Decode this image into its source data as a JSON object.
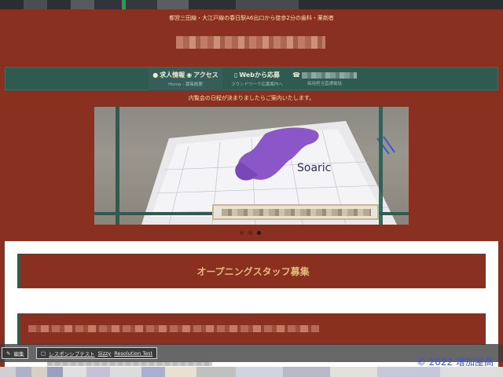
{
  "subtitle": "都営三田線・大江戸線の春日駅A6出口から徒歩2分の歯科・薬剤者",
  "nav": {
    "items": [
      {
        "main": "求人情報",
        "sub": "Home - 募集概要",
        "icon": "user-icon"
      },
      {
        "main": "アクセス",
        "sub": "",
        "icon": "map-pin-icon"
      },
      {
        "main": "Webから応募",
        "sub": "ラウンドワーク応募案内へ",
        "icon": "tablet-icon"
      },
      {
        "main": "",
        "sub": "採用担当直通電話",
        "icon": "phone-icon"
      }
    ]
  },
  "notice": "内覧会の日程が決まりましたらご案内いたします。",
  "carousel": {
    "image_text": "Soaric",
    "slides": 3,
    "active_slide": 3
  },
  "sections": {
    "heading1": "オープニングスタッフ募集"
  },
  "bottombar": {
    "edit_label": "編集",
    "responsive_label": "レスポンシブテスト",
    "sizzy_label": "Sizzy",
    "resolution_label": "Resolution Test"
  },
  "copyright": "© 2022 增加屋高",
  "colors": {
    "brand_red": "#8a3020",
    "nav_green": "#2f5a50",
    "heading_gold": "#e3b87a"
  }
}
